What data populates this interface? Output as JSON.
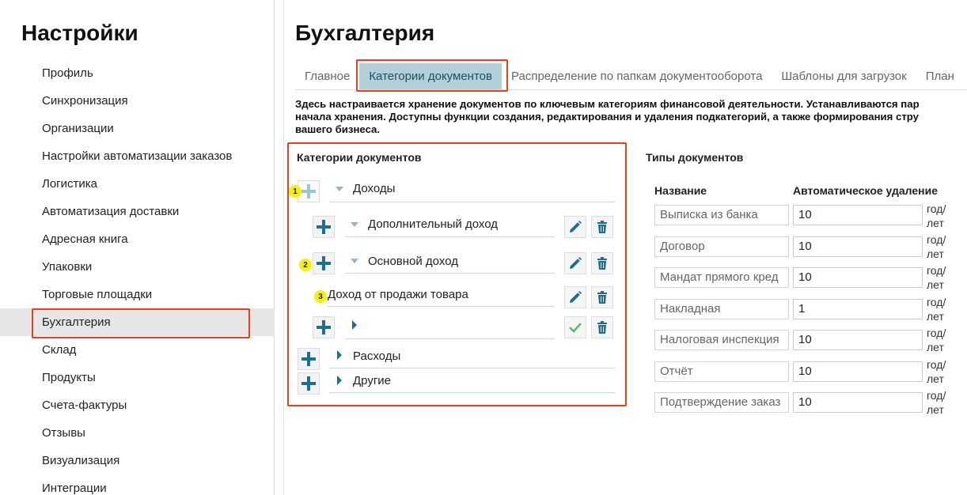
{
  "sidebar": {
    "title": "Настройки",
    "items": [
      {
        "label": "Профиль"
      },
      {
        "label": "Синхронизация"
      },
      {
        "label": "Организации"
      },
      {
        "label": "Настройки автоматизации заказов"
      },
      {
        "label": "Логистика"
      },
      {
        "label": "Автоматизация доставки"
      },
      {
        "label": "Адресная книга"
      },
      {
        "label": "Упаковки"
      },
      {
        "label": "Торговые площадки"
      },
      {
        "label": "Бухгалтерия",
        "active": true
      },
      {
        "label": "Склад"
      },
      {
        "label": "Продукты"
      },
      {
        "label": "Счета-фактуры"
      },
      {
        "label": "Отзывы"
      },
      {
        "label": "Визуализация"
      },
      {
        "label": "Интеграции"
      }
    ]
  },
  "main": {
    "title": "Бухгалтерия",
    "tabs": [
      {
        "label": "Главное"
      },
      {
        "label": "Категории документов",
        "active": true
      },
      {
        "label": "Распределение по папкам документооборота"
      },
      {
        "label": "Шаблоны для загрузок"
      },
      {
        "label": "План"
      }
    ],
    "description": [
      "Здесь настраивается хранение документов по ключевым категориям финансовой деятельности. Устанавливаются пар",
      "начала хранения. Доступны функции создания, редактирования и удаления подкатегорий, а также формирования стру",
      "вашего бизнеса."
    ]
  },
  "categories": {
    "title": "Категории документов",
    "top_income": "Доходы",
    "extra_income": "Дополнительный доход",
    "main_income": "Основной доход",
    "sale_income": "Доход от продажи товара",
    "new_item": "",
    "expenses": "Расходы",
    "others": "Другие",
    "badges": [
      "1",
      "2",
      "3"
    ]
  },
  "doc_types": {
    "title": "Типы документов",
    "col_name": "Название",
    "col_auto_delete": "Автоматическое удаление",
    "unit_line1": "год/",
    "unit_line2": "лет",
    "rows": [
      {
        "name": "Выписка из банка",
        "value": "10"
      },
      {
        "name": "Договор",
        "value": "10"
      },
      {
        "name": "Мандат прямого кред",
        "value": "10"
      },
      {
        "name": "Накладная",
        "value": "1"
      },
      {
        "name": "Налоговая инспекция",
        "value": "10"
      },
      {
        "name": "Отчёт",
        "value": "10"
      },
      {
        "name": "Подтверждение заказ",
        "value": "10"
      }
    ]
  },
  "colors": {
    "accent": "#1e6f8f",
    "highlight": "#e8401c",
    "tab_active_bg": "#b3d0da",
    "badge": "#f5f10f",
    "check": "#5fb87a"
  }
}
